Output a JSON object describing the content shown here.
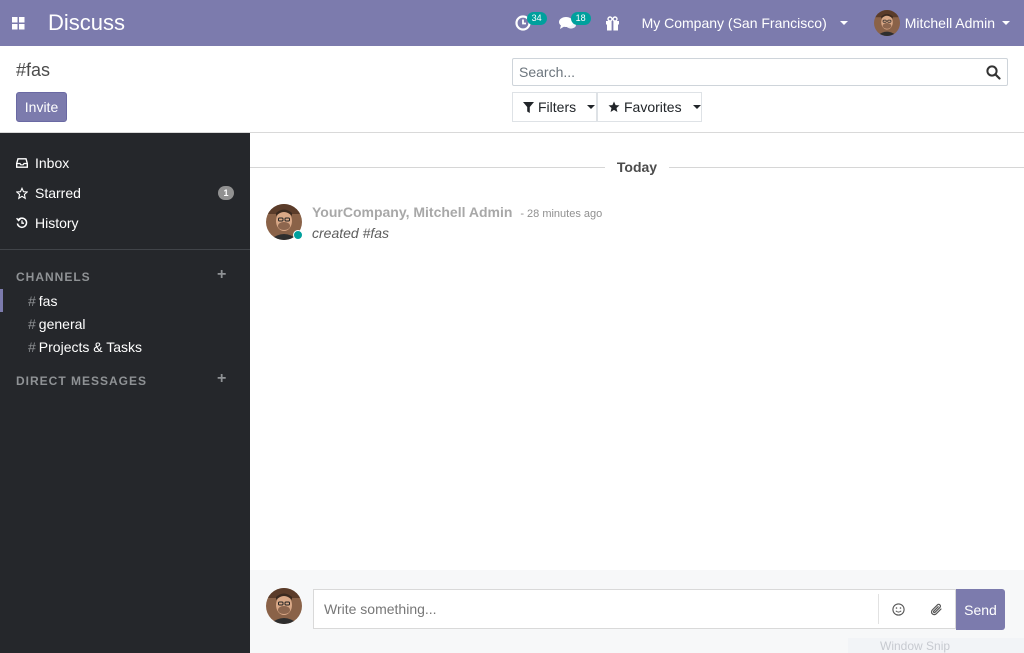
{
  "navbar": {
    "app_title": "Discuss",
    "activity_count": "34",
    "messages_count": "18",
    "company": "My Company (San Francisco)",
    "user_name": "Mitchell Admin",
    "colors": {
      "bar": "#7c7bad",
      "badge": "#00a09d"
    },
    "icons": [
      "apps-grid-icon",
      "activity-clock-icon",
      "chat-bubbles-icon",
      "gift-icon"
    ]
  },
  "control_panel": {
    "breadcrumb": "#fas",
    "invite_label": "Invite",
    "search_placeholder": "Search...",
    "filters_label": "Filters",
    "favorites_label": "Favorites"
  },
  "sidebar": {
    "mailboxes": [
      {
        "label": "Inbox",
        "icon": "inbox-icon"
      },
      {
        "label": "Starred",
        "icon": "star-icon",
        "badge": "1"
      },
      {
        "label": "History",
        "icon": "history-icon"
      }
    ],
    "channels_header": "CHANNELS",
    "channels": [
      {
        "label": "fas",
        "active": true
      },
      {
        "label": "general"
      },
      {
        "label": "Projects & Tasks"
      }
    ],
    "dm_header": "DIRECT MESSAGES"
  },
  "thread": {
    "date_label": "Today",
    "messages": [
      {
        "author": "YourCompany, Mitchell Admin",
        "date": "- 28 minutes ago",
        "body": "created #fas"
      }
    ]
  },
  "composer": {
    "placeholder": "Write something...",
    "send_label": "Send"
  },
  "overlay": {
    "window_snip": "Window Snip"
  }
}
